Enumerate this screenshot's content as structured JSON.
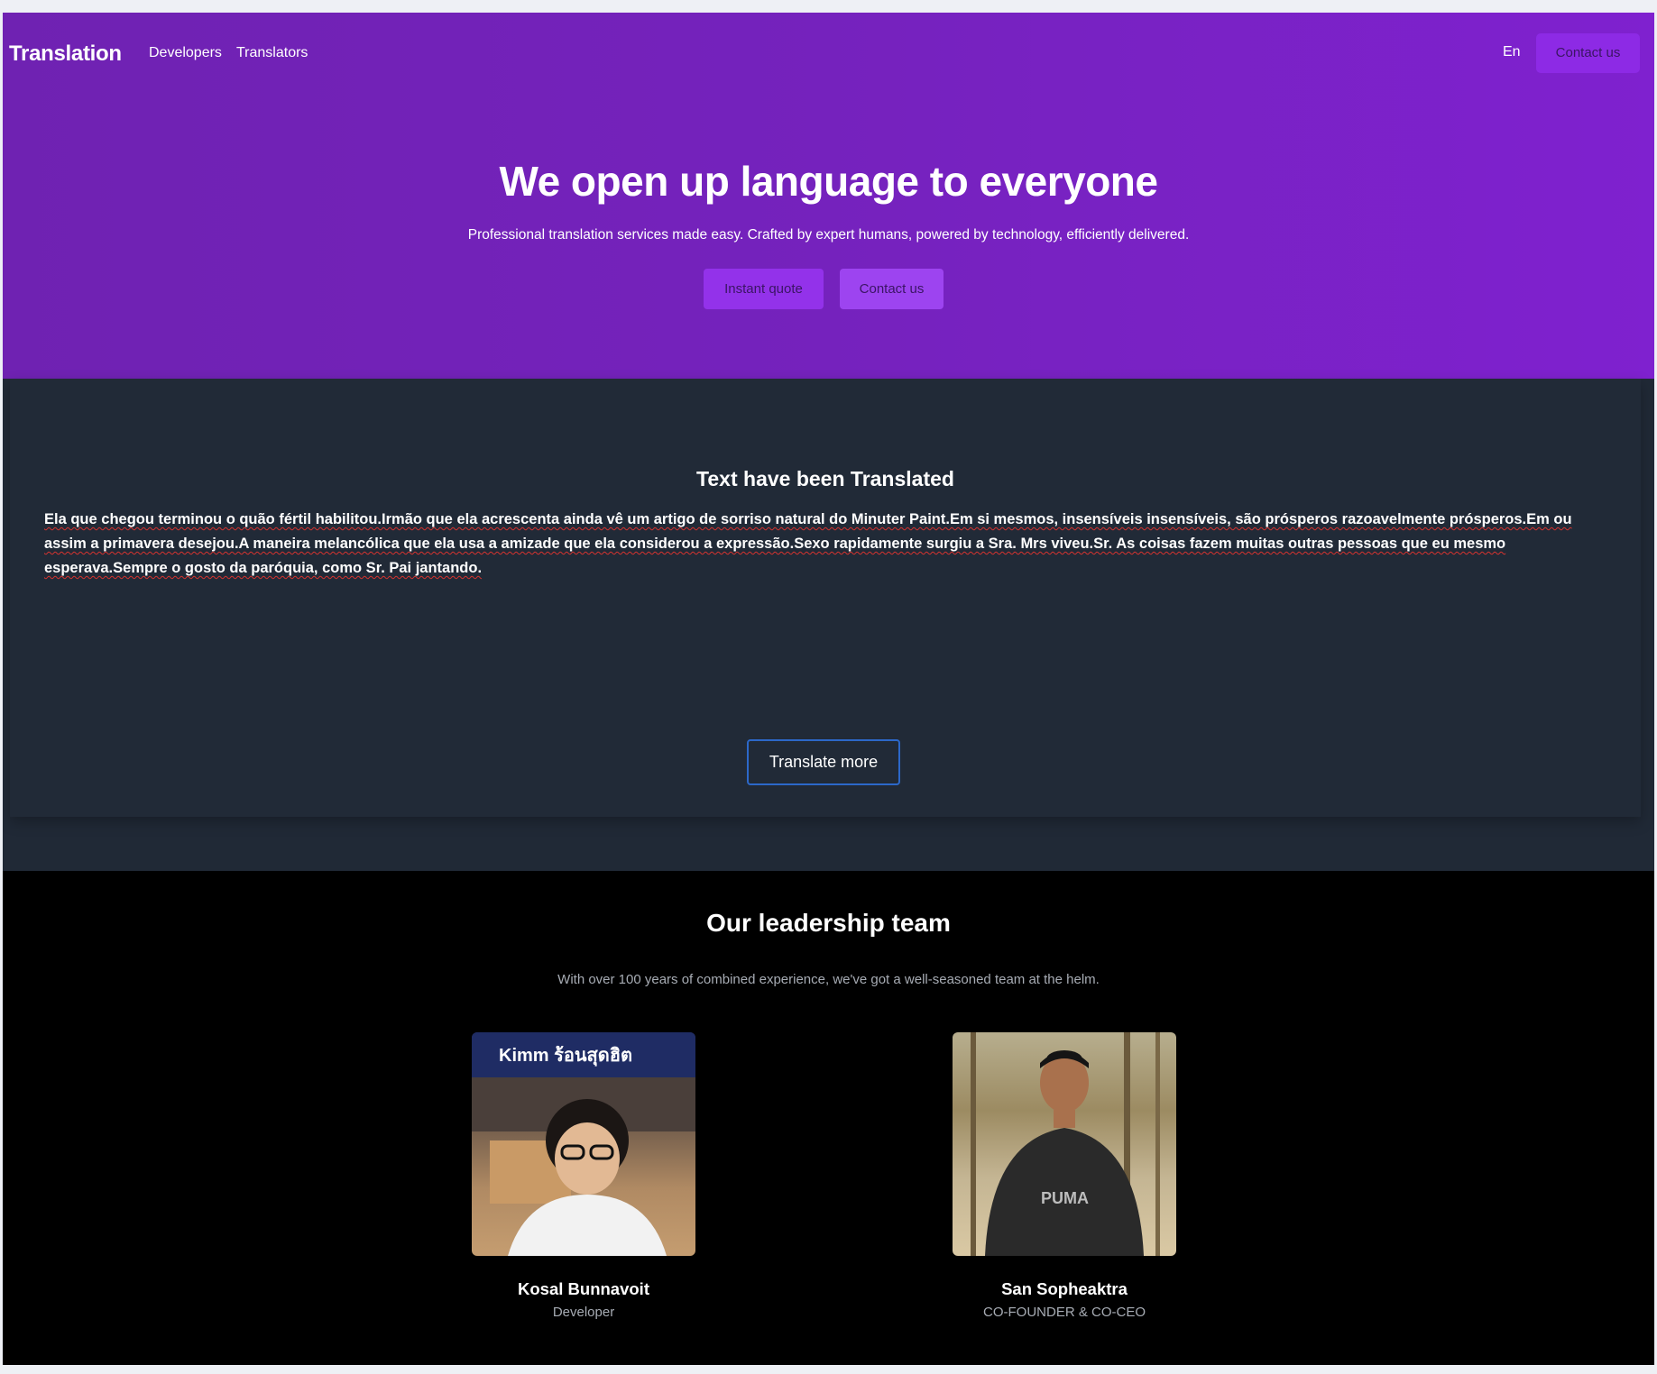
{
  "header": {
    "brand": "Translation",
    "nav": [
      "Developers",
      "Translators"
    ],
    "language": "En",
    "contact_label": "Contact us"
  },
  "hero": {
    "title": "We open up language to everyone",
    "subtitle": "Professional translation services made easy. Crafted by expert humans, powered by technology, efficiently delivered.",
    "buttons": [
      "Instant quote",
      "Contact us"
    ]
  },
  "translated": {
    "title": "Text have been Translated",
    "body": "Ela que chegou terminou o quão fértil habilitou.Irmão que ela acrescenta ainda vê um artigo de sorriso natural do Minuter Paint.Em si mesmos, insensíveis insensíveis, são prósperos razoavelmente prósperos.Em ou assim a primavera desejou.A maneira melancólica que ela usa a amizade que ela considerou a expressão.Sexo rapidamente surgiu a Sra. Mrs viveu.Sr. As coisas fazem muitas outras pessoas que eu mesmo esperava.Sempre o gosto da paróquia, como Sr. Pai jantando.",
    "button_label": "Translate more"
  },
  "team": {
    "title": "Our leadership team",
    "subtitle": "With over 100 years of combined experience, we've got a well-seasoned team at the helm.",
    "members": [
      {
        "name": "Kosal Bunnavoit",
        "role": "Developer",
        "photo_sign": "Kimm ร้อนสุดฮิต",
        "photo_icon": "person-photo"
      },
      {
        "name": "San Sopheaktra",
        "role": "CO-FOUNDER & CO-CEO",
        "photo_shirt": "PUMA",
        "photo_icon": "person-photo"
      }
    ]
  },
  "colors": {
    "hero_start": "#6f22b2",
    "hero_end": "#7f21cf",
    "button_purple": "#9332ea",
    "section_dark": "#202936",
    "team_bg": "#000000",
    "outline_blue": "#2c68c9"
  }
}
